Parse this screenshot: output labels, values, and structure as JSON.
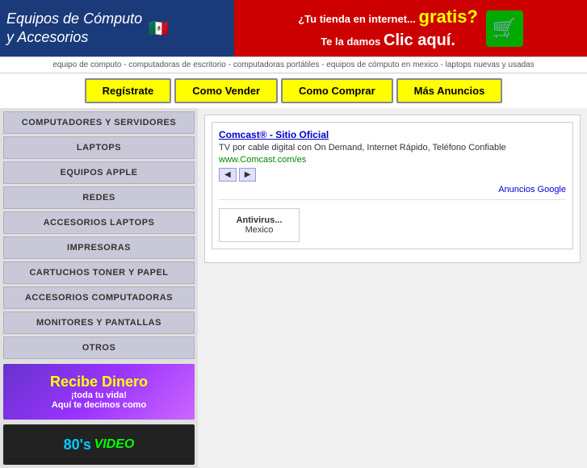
{
  "header": {
    "left_line1": "Equipos de Cómputo",
    "left_line2": "y Accesorios",
    "flag": "🇲🇽",
    "right_question": "¿Tu tienda en internet...",
    "right_gratis": "gratis?",
    "right_action": "Te la damos",
    "right_clic": "Clic aquí.",
    "cart_icon": "🛒"
  },
  "breadcrumb": {
    "text": "equipo de computo - computadoras de escritorio - computadoras portátiles - equipos de cómputo en mexico - laptops nuevas y usadas"
  },
  "nav": {
    "btn1": "Regístrate",
    "btn2": "Como Vender",
    "btn3": "Como Comprar",
    "btn4": "Más Anuncios"
  },
  "sidebar": {
    "items": [
      "COMPUTADORES Y SERVIDORES",
      "LAPTOPS",
      "EQUIPOS APPLE",
      "REDES",
      "ACCESORIOS LAPTOPS",
      "IMPRESORAS",
      "CARTUCHOS TONER Y PAPEL",
      "ACCESORIOS COMPUTADORAS",
      "MONITORES Y PANTALLAS",
      "OTROS"
    ],
    "banner1_title": "Recibe Dinero",
    "banner1_sub1": "¡toda tu vida!",
    "banner1_sub2": "Aquí te decimos como",
    "banner2_eighty": "80's",
    "banner2_video": "VIDEO"
  },
  "ad": {
    "title": "Comcast® - Sitio Oficial",
    "description": "TV por cable digital con On Demand, Internet Rápido, Teléfono Confiable",
    "url": "www.Comcast.com/es",
    "nav_back": "◀",
    "nav_fwd": "▶",
    "google_label": "Anuncios Google"
  },
  "secondary_ad": {
    "title": "Antivirus...",
    "subtitle": "Mexico"
  }
}
